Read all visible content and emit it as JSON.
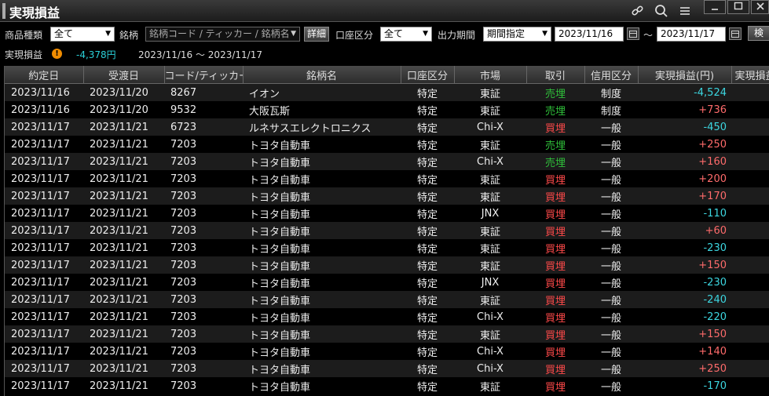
{
  "window": {
    "title": "実現損益"
  },
  "filters": {
    "product_type_label": "商品種類",
    "product_type_value": "全て",
    "symbol_label": "銘柄",
    "symbol_placeholder": "銘柄コード / ティッカー / 銘柄名",
    "detail_button": "詳細",
    "account_type_label": "口座区分",
    "account_type_value": "全て",
    "period_label": "出力期間",
    "period_value": "期間指定",
    "date_from": "2023/11/16",
    "date_sep": "～",
    "date_to": "2023/11/17",
    "search_button": "検"
  },
  "summary": {
    "label": "実現損益",
    "warn_glyph": "!",
    "total": "-4,378円",
    "range": "2023/11/16 ～ 2023/11/17"
  },
  "table": {
    "columns": [
      "約定日",
      "受渡日",
      "コード/ティッカー",
      "銘柄名",
      "口座区分",
      "市場",
      "取引",
      "信用区分",
      "実現損益(円)",
      "実現損益"
    ],
    "rows": [
      [
        "2023/11/16",
        "2023/11/20",
        "8267",
        "イオン",
        "特定",
        "東証",
        "売埋",
        "制度",
        "-4,524"
      ],
      [
        "2023/11/16",
        "2023/11/20",
        "9532",
        "大阪瓦斯",
        "特定",
        "東証",
        "売埋",
        "制度",
        "+736"
      ],
      [
        "2023/11/17",
        "2023/11/21",
        "6723",
        "ルネサスエレクトロニクス",
        "特定",
        "Chi-X",
        "買埋",
        "一般",
        "-450"
      ],
      [
        "2023/11/17",
        "2023/11/21",
        "7203",
        "トヨタ自動車",
        "特定",
        "東証",
        "売埋",
        "一般",
        "+250"
      ],
      [
        "2023/11/17",
        "2023/11/21",
        "7203",
        "トヨタ自動車",
        "特定",
        "Chi-X",
        "売埋",
        "一般",
        "+160"
      ],
      [
        "2023/11/17",
        "2023/11/21",
        "7203",
        "トヨタ自動車",
        "特定",
        "東証",
        "買埋",
        "一般",
        "+200"
      ],
      [
        "2023/11/17",
        "2023/11/21",
        "7203",
        "トヨタ自動車",
        "特定",
        "東証",
        "買埋",
        "一般",
        "+170"
      ],
      [
        "2023/11/17",
        "2023/11/21",
        "7203",
        "トヨタ自動車",
        "特定",
        "JNX",
        "買埋",
        "一般",
        "-110"
      ],
      [
        "2023/11/17",
        "2023/11/21",
        "7203",
        "トヨタ自動車",
        "特定",
        "東証",
        "買埋",
        "一般",
        "+60"
      ],
      [
        "2023/11/17",
        "2023/11/21",
        "7203",
        "トヨタ自動車",
        "特定",
        "東証",
        "買埋",
        "一般",
        "-230"
      ],
      [
        "2023/11/17",
        "2023/11/21",
        "7203",
        "トヨタ自動車",
        "特定",
        "東証",
        "買埋",
        "一般",
        "+150"
      ],
      [
        "2023/11/17",
        "2023/11/21",
        "7203",
        "トヨタ自動車",
        "特定",
        "JNX",
        "買埋",
        "一般",
        "-230"
      ],
      [
        "2023/11/17",
        "2023/11/21",
        "7203",
        "トヨタ自動車",
        "特定",
        "東証",
        "買埋",
        "一般",
        "-240"
      ],
      [
        "2023/11/17",
        "2023/11/21",
        "7203",
        "トヨタ自動車",
        "特定",
        "Chi-X",
        "買埋",
        "一般",
        "-220"
      ],
      [
        "2023/11/17",
        "2023/11/21",
        "7203",
        "トヨタ自動車",
        "特定",
        "東証",
        "買埋",
        "一般",
        "+150"
      ],
      [
        "2023/11/17",
        "2023/11/21",
        "7203",
        "トヨタ自動車",
        "特定",
        "Chi-X",
        "買埋",
        "一般",
        "+140"
      ],
      [
        "2023/11/17",
        "2023/11/21",
        "7203",
        "トヨタ自動車",
        "特定",
        "Chi-X",
        "買埋",
        "一般",
        "+250"
      ],
      [
        "2023/11/17",
        "2023/11/21",
        "7203",
        "トヨタ自動車",
        "特定",
        "東証",
        "買埋",
        "一般",
        "-170"
      ]
    ]
  },
  "colors": {
    "sell": "#2fbf3a",
    "buy": "#ff4a4a",
    "profit": "#ff6b6b",
    "loss": "#3cd6e0",
    "summary": "#2ad0d8"
  },
  "icons": [
    "link-icon",
    "search-icon",
    "menu-icon",
    "minimize-icon",
    "maximize-icon",
    "close-icon",
    "calendar-icon",
    "warning-icon"
  ]
}
